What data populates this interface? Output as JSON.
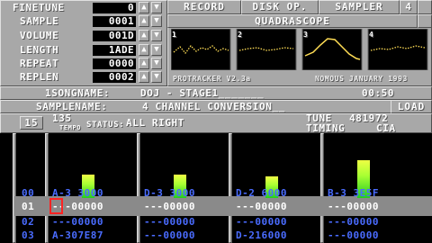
{
  "params": [
    {
      "label": "FINETUNE",
      "value": "0"
    },
    {
      "label": "SAMPLE",
      "value": "0001"
    },
    {
      "label": "VOLUME",
      "value": "001D"
    },
    {
      "label": "LENGTH",
      "value": "1ADE"
    },
    {
      "label": "REPEAT",
      "value": "0000"
    },
    {
      "label": "REPLEN",
      "value": "0002"
    }
  ],
  "buttons": {
    "record": "RECORD",
    "disk_op": "DISK OP.",
    "sampler": "SAMPLER",
    "track_count": "4"
  },
  "quadrascope": {
    "title": "QUADRASCOPE",
    "channel_numbers": [
      "1",
      "2",
      "3",
      "4"
    ]
  },
  "credits": {
    "left": "PROTRACKER V2.3a",
    "right": "NOMOUS JANUARY 1993"
  },
  "song": {
    "label": "1SONGNAME:",
    "name": "DOJ - STAGE1_______",
    "time": "00:50"
  },
  "sample": {
    "label": "SAMPLENAME:",
    "name": "4 CHANNEL CONVERSION__",
    "load": "LOAD"
  },
  "status": {
    "octave": "15",
    "tempo": "135",
    "tempo_label": "TEMPO",
    "status_label": "STATUS:",
    "status_text": "ALL RIGHT",
    "tune_label": "TUNE",
    "tune_value": "481972",
    "timing_label": "TIMING",
    "timing_value": "CIA"
  },
  "pattern": {
    "rows": [
      "00",
      "01",
      "02",
      "03"
    ],
    "channels": [
      {
        "prev": "A-3 3000",
        "cur": "---00000",
        "next": "---00000",
        "next2": "A-307E87",
        "vu": 0.33
      },
      {
        "prev": "D-3 3000",
        "cur": "---00000",
        "next": "---00000",
        "next2": "---00000",
        "vu": 0.33
      },
      {
        "prev": "D-2 6000",
        "cur": "---00000",
        "next": "---00000",
        "next2": "D-216000",
        "vu": 0.3
      },
      {
        "prev": "B-3 3E5F",
        "cur": "---00000",
        "next": "---00000",
        "next2": "---00000",
        "vu": 0.52
      }
    ]
  },
  "colors": {
    "panel": "#a8a8a8",
    "pattern_text": "#4a6cff",
    "vu_bar": "#44dd22",
    "cursor": "#ff2222"
  }
}
